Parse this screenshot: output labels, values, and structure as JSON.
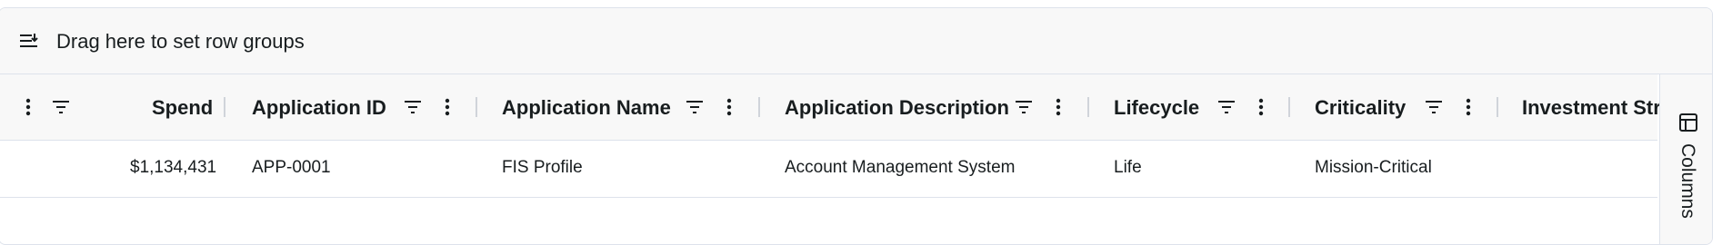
{
  "group_panel": {
    "label": "Drag here to set row groups",
    "icon": "row-group-icon"
  },
  "columns": [
    {
      "id": "spend",
      "label": "Spend"
    },
    {
      "id": "application-id",
      "label": "Application ID"
    },
    {
      "id": "application-name",
      "label": "Application Name"
    },
    {
      "id": "application-description",
      "label": "Application Description"
    },
    {
      "id": "lifecycle",
      "label": "Lifecycle"
    },
    {
      "id": "criticality",
      "label": "Criticality"
    },
    {
      "id": "investment-strategy",
      "label": "Investment Strat"
    }
  ],
  "rows": [
    {
      "spend": "$1,134,431",
      "application_id": "APP-0001",
      "application_name": "FIS Profile",
      "application_description": "Account Management System",
      "lifecycle": "Life",
      "criticality": "Mission-Critical"
    }
  ],
  "side_bar": {
    "columns_label": "Columns",
    "icon": "columns-panel-icon"
  },
  "icons": {
    "filter": "filter-icon",
    "menu": "column-menu-icon"
  },
  "colors": {
    "header_bg": "#f8f8f8",
    "border": "#dde2eb",
    "text": "#181d1f"
  }
}
